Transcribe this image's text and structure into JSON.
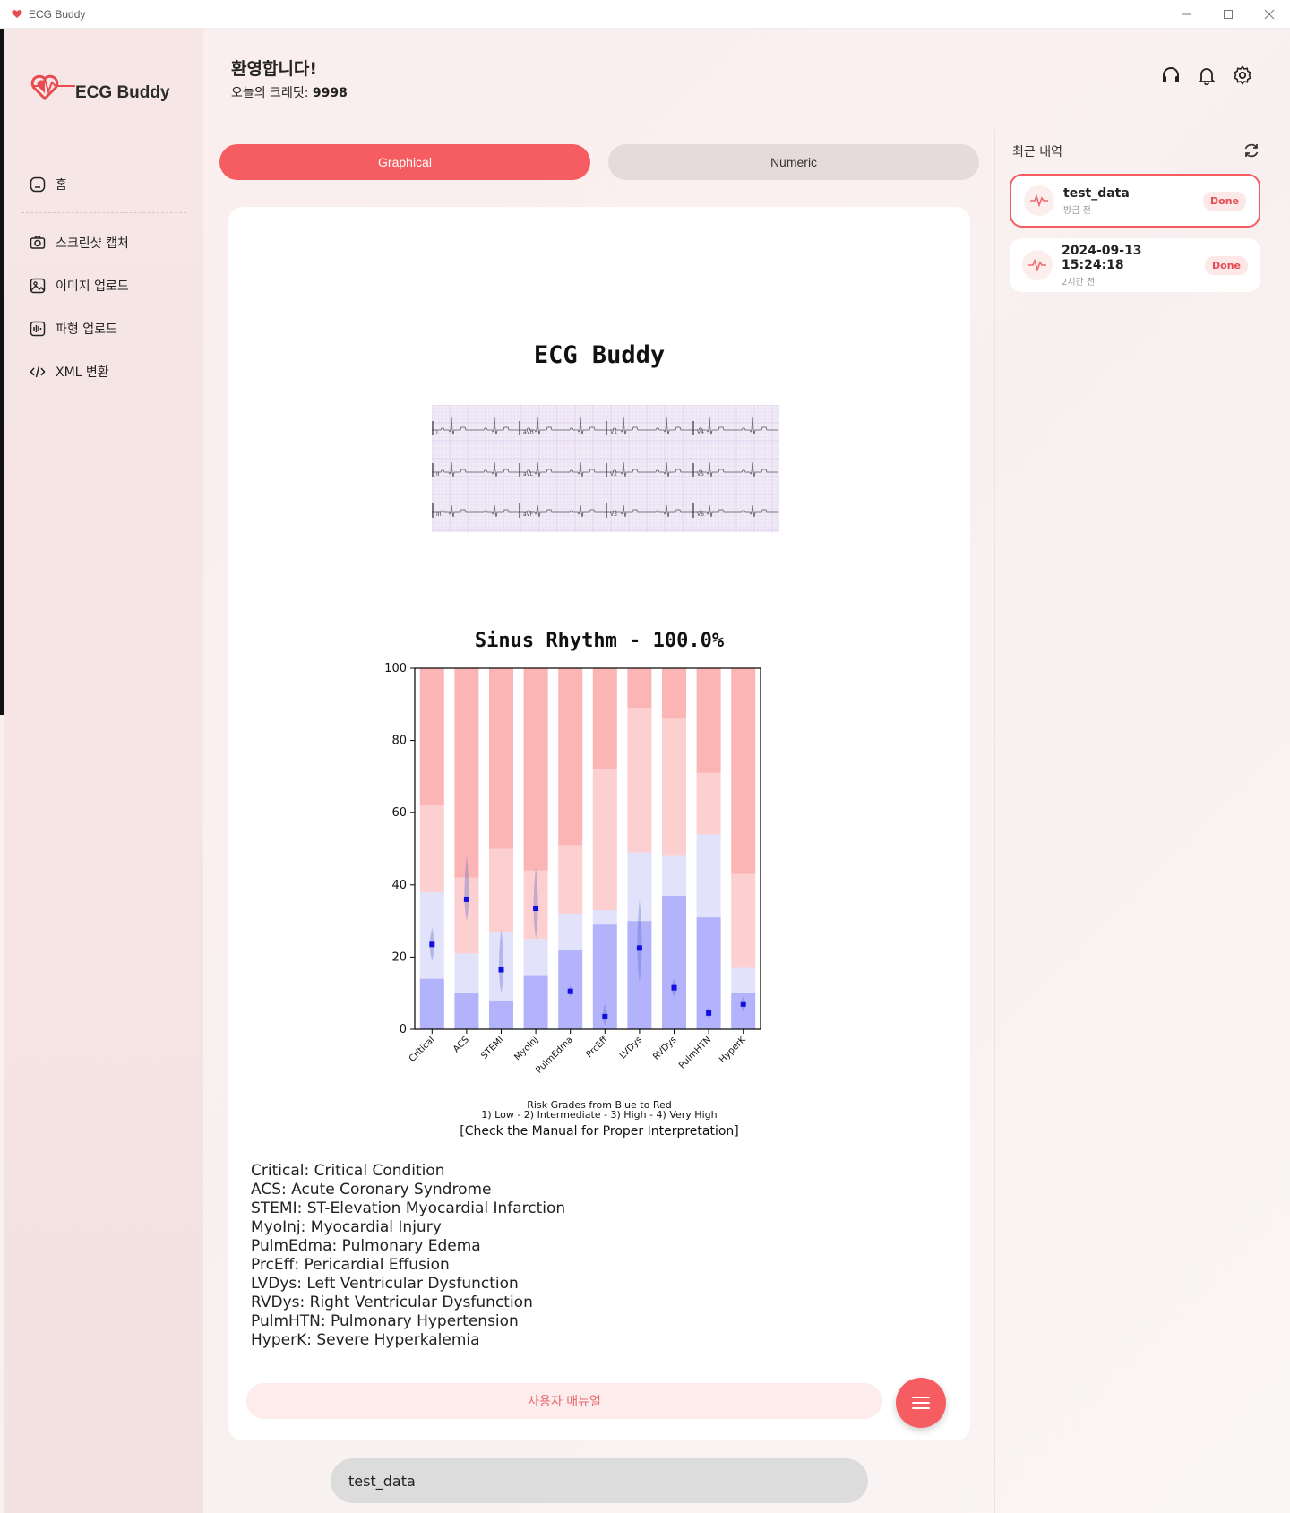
{
  "window": {
    "title": "ECG Buddy"
  },
  "sidebar": {
    "logo_text": "ECG Buddy",
    "items": [
      {
        "label": "홈",
        "icon": "home-icon"
      },
      {
        "label": "스크린샷 캡처",
        "icon": "camera-icon"
      },
      {
        "label": "이미지 업로드",
        "icon": "image-icon"
      },
      {
        "label": "파형 업로드",
        "icon": "waveform-icon"
      },
      {
        "label": "XML 변환",
        "icon": "code-icon"
      }
    ]
  },
  "header": {
    "welcome": "환영합니다!",
    "credit_label": "오늘의 크레딧:",
    "credit_value": "9998",
    "icons": [
      "headset-icon",
      "bell-icon",
      "gear-icon"
    ]
  },
  "tabs": [
    {
      "label": "Graphical",
      "active": true
    },
    {
      "label": "Numeric",
      "active": false
    }
  ],
  "report": {
    "title": "ECG Buddy",
    "ecg_leads": [
      "I",
      "aVR",
      "V1",
      "V4",
      "II",
      "aVL",
      "V2",
      "V5",
      "III",
      "aVF",
      "V3",
      "V6"
    ],
    "chart_footnote1": "Risk Grades from Blue to Red",
    "chart_footnote2": "1) Low - 2) Intermediate - 3) High - 4) Very High",
    "chart_footnote3": "[Check the Manual for Proper Interpretation]",
    "abbreviations": [
      "Critical: Critical Condition",
      "ACS: Acute Coronary Syndrome",
      "STEMI: ST-Elevation Myocardial Infarction",
      "MyoInj: Myocardial Injury",
      "PulmEdma: Pulmonary Edema",
      "PrcEff: Pericardial Effusion",
      "LVDys: Left Ventricular Dysfunction",
      "RVDys: Right Ventricular Dysfunction",
      "PulmHTN: Pulmonary Hypertension",
      "HyperK: Severe Hyperkalemia"
    ],
    "manual_button": "사용자 매뉴얼"
  },
  "chart_data": {
    "type": "bar",
    "title": "Sinus Rhythm - 100.0%",
    "categories": [
      "Critical",
      "ACS",
      "STEMI",
      "MyoInj",
      "PulmEdma",
      "PrcEff",
      "LVDys",
      "RVDys",
      "PulmHTN",
      "HyperK"
    ],
    "ylim": [
      0,
      100
    ],
    "yticks": [
      0,
      20,
      40,
      60,
      80,
      100
    ],
    "grade_thresholds": [
      [
        14,
        38,
        62
      ],
      [
        10,
        21,
        42
      ],
      [
        8,
        27,
        50
      ],
      [
        15,
        25,
        44
      ],
      [
        22,
        32,
        51
      ],
      [
        29,
        33,
        72
      ],
      [
        30,
        49,
        89
      ],
      [
        37,
        48,
        86
      ],
      [
        31,
        54,
        71
      ],
      [
        10,
        17,
        43
      ]
    ],
    "grade_colors": [
      "#b3b3fb",
      "#e2e2fb",
      "#fcd0d0",
      "#fbb5b5"
    ],
    "scores": [
      23.5,
      36,
      16.5,
      33.5,
      10.5,
      3.5,
      22.5,
      11.5,
      4.5,
      7
    ],
    "violin_ranges": [
      [
        19,
        28
      ],
      [
        30,
        48
      ],
      [
        10,
        28
      ],
      [
        25,
        45
      ],
      [
        9,
        12
      ],
      [
        1,
        7
      ],
      [
        13,
        36
      ],
      [
        9,
        14
      ],
      [
        3,
        6
      ],
      [
        5,
        9
      ]
    ]
  },
  "bottom_input": {
    "value": "test_data"
  },
  "history": {
    "title": "최근 내역",
    "items": [
      {
        "name": "test_data",
        "time": "방금 전",
        "status": "Done",
        "active": true
      },
      {
        "name": "2024-09-13 15:24:18",
        "time": "2시간 전",
        "status": "Done",
        "active": false
      }
    ]
  }
}
